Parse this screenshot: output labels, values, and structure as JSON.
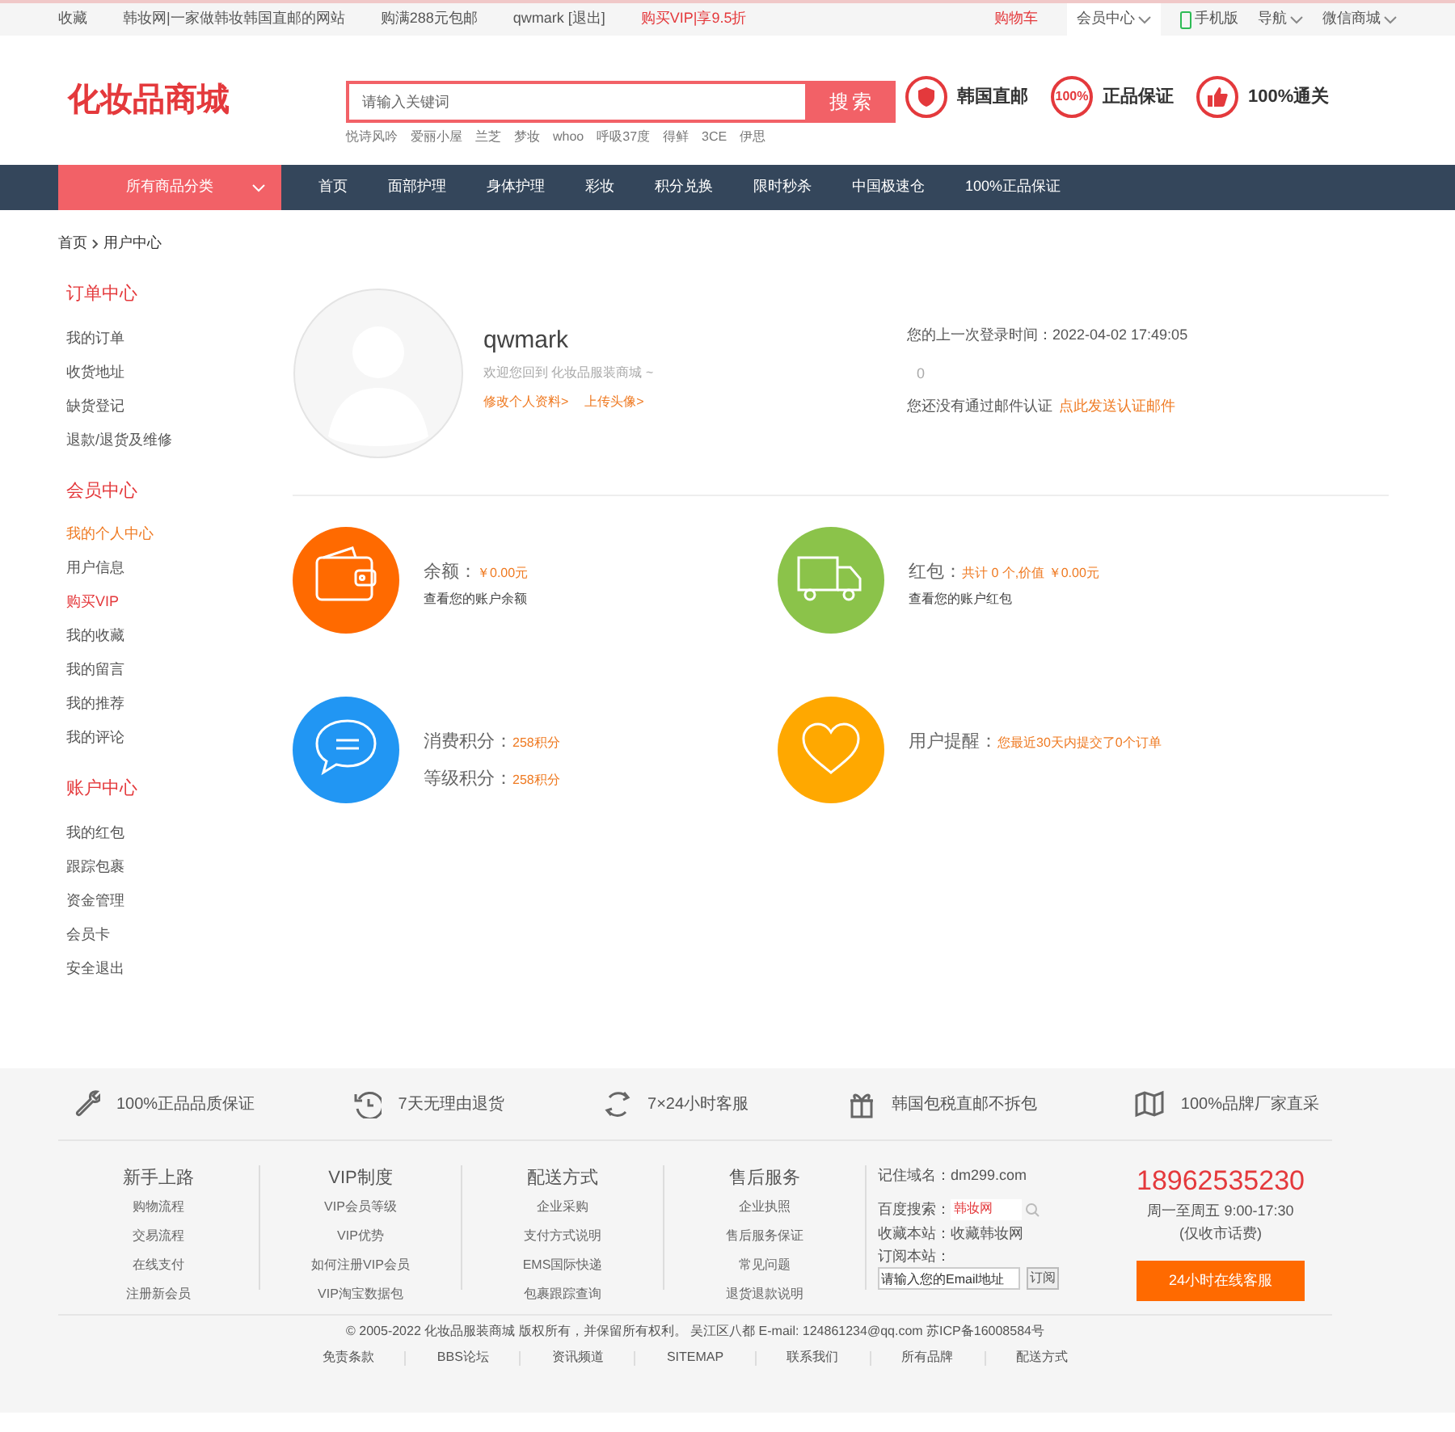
{
  "top_bar": {
    "left": [
      "收藏",
      "韩妆网|一家做韩妆韩国直邮的网站",
      "购满288元包邮",
      "qwmark [退出]"
    ],
    "promo": "购买VIP|享9.5折",
    "cart": "购物车",
    "menus": [
      {
        "label": "会员中心",
        "kind": "dropdown"
      },
      {
        "label": "手机版",
        "kind": "phone"
      },
      {
        "label": "导航",
        "kind": "dropdown"
      },
      {
        "label": "微信商城",
        "kind": "dropdown"
      }
    ]
  },
  "header": {
    "logo": "化妆品商城",
    "search": {
      "placeholder": "请输入关键词",
      "button": "搜索"
    },
    "hot_words": [
      "悦诗风吟",
      "爱丽小屋",
      "兰芝",
      "梦妆",
      "whoo",
      "呼吸37度",
      "得鲜",
      "3CE",
      "伊思"
    ],
    "badges": [
      {
        "kind": "shield",
        "label": "韩国直邮"
      },
      {
        "kind": "percent",
        "icon_text": "100%",
        "label": "正品保证"
      },
      {
        "kind": "thumb",
        "label": "100%通关"
      }
    ]
  },
  "nav": {
    "category": "所有商品分类",
    "items": [
      "首页",
      "面部护理",
      "身体护理",
      "彩妆",
      "积分兑换",
      "限时秒杀",
      "中国极速仓",
      "100%正品保证"
    ]
  },
  "breadcrumb": [
    "首页",
    "用户中心"
  ],
  "sidebar": [
    {
      "title": "订单中心",
      "items": [
        {
          "label": "我的订单",
          "selected": false,
          "highlighted": false
        },
        {
          "label": "收货地址",
          "selected": false,
          "highlighted": false
        },
        {
          "label": "缺货登记",
          "selected": false,
          "highlighted": false
        },
        {
          "label": "退款/退货及维修",
          "selected": false,
          "highlighted": false
        }
      ]
    },
    {
      "title": "会员中心",
      "items": [
        {
          "label": "我的个人中心",
          "selected": true,
          "highlighted": false
        },
        {
          "label": "用户信息",
          "selected": false,
          "highlighted": false
        },
        {
          "label": "购买VIP",
          "selected": false,
          "highlighted": true
        },
        {
          "label": "我的收藏",
          "selected": false,
          "highlighted": false
        },
        {
          "label": "我的留言",
          "selected": false,
          "highlighted": false
        },
        {
          "label": "我的推荐",
          "selected": false,
          "highlighted": false
        },
        {
          "label": "我的评论",
          "selected": false,
          "highlighted": false
        }
      ]
    },
    {
      "title": "账户中心",
      "items": [
        {
          "label": "我的红包",
          "selected": false,
          "highlighted": false
        },
        {
          "label": "跟踪包裹",
          "selected": false,
          "highlighted": false
        },
        {
          "label": "资金管理",
          "selected": false,
          "highlighted": false
        },
        {
          "label": "会员卡",
          "selected": false,
          "highlighted": false
        },
        {
          "label": "安全退出",
          "selected": false,
          "highlighted": false
        }
      ]
    }
  ],
  "profile": {
    "username": "qwmark",
    "welcome": "欢迎您回到 化妆品服装商城 ~",
    "links": [
      "修改个人资料>",
      "上传头像>"
    ],
    "last_login_label": "您的上一次登录时间：",
    "last_login": "2022-04-02 17:49:05",
    "count": "0",
    "email_notice": "您还没有通过邮件认证",
    "email_link": "点此发送认证邮件"
  },
  "stats": [
    {
      "kind": "wallet",
      "color": "#ff6a00",
      "lines": [
        {
          "label": "余额：",
          "value": "￥0.00元"
        }
      ],
      "note": "查看您的账户余额"
    },
    {
      "kind": "truck",
      "color": "#8bc34a",
      "lines": [
        {
          "label": "红包：",
          "value": "共计 0 个,价值 ￥0.00元"
        }
      ],
      "note": "查看您的账户红包"
    },
    {
      "kind": "chat",
      "color": "#2196f3",
      "lines": [
        {
          "label": "消费积分：",
          "value": "258积分"
        },
        {
          "label": "等级积分：",
          "value": "258积分"
        }
      ]
    },
    {
      "kind": "heart",
      "color": "#ffa800",
      "lines": [
        {
          "label": "用户提醒：",
          "value": "您最近30天内提交了0个订单"
        }
      ]
    }
  ],
  "guarantees": [
    {
      "kind": "wrench",
      "label": "100%正品品质保证"
    },
    {
      "kind": "clock",
      "label": "7天无理由退货"
    },
    {
      "kind": "refresh",
      "label": "7×24小时客服"
    },
    {
      "kind": "gift",
      "label": "韩国包税直邮不拆包"
    },
    {
      "kind": "map",
      "label": "100%品牌厂家直采"
    }
  ],
  "help_columns": [
    {
      "title": "新手上路",
      "links": [
        "购物流程",
        "交易流程",
        "在线支付",
        "注册新会员"
      ]
    },
    {
      "title": "VIP制度",
      "links": [
        "VIP会员等级",
        "VIP优势",
        "如何注册VIP会员",
        "VIP淘宝数据包"
      ]
    },
    {
      "title": "配送方式",
      "links": [
        "企业采购",
        "支付方式说明",
        "EMS国际快递",
        "包裹跟踪查询"
      ]
    },
    {
      "title": "售后服务",
      "links": [
        "企业执照",
        "售后服务保证",
        "常见问题",
        "退货退款说明"
      ]
    }
  ],
  "site_info": {
    "domain": "记住域名：dm299.com",
    "baidu_label": "百度搜索：",
    "baidu_value": "韩妆网",
    "bookmark": "收藏本站：收藏韩妆网",
    "subscribe_label": "订阅本站：",
    "email_placeholder": "请输入您的Email地址",
    "subscribe_button": "订阅"
  },
  "contact": {
    "phone": "18962535230",
    "hours": "周一至周五 9:00-17:30",
    "note": "(仅收市话费)",
    "button": "24小时在线客服"
  },
  "copyright": "© 2005-2022 化妆品服装商城 版权所有，并保留所有权利。 吴江区八都 E-mail: 124861234@qq.com 苏ICP备16008584号",
  "footer_links": [
    "免责条款",
    "BBS论坛",
    "资讯频道",
    "SITEMAP",
    "联系我们",
    "所有品牌",
    "配送方式"
  ]
}
